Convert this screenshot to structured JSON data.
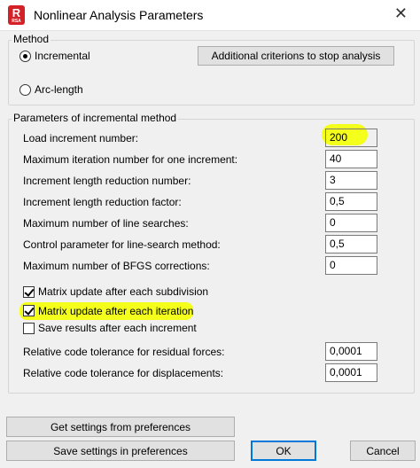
{
  "window": {
    "title": "Nonlinear Analysis Parameters",
    "app_icon_letter": "R",
    "app_icon_sub": "RSA",
    "close_glyph": "✕"
  },
  "method": {
    "group_label": "Method",
    "options": [
      {
        "label": "Incremental",
        "selected": true
      },
      {
        "label": "Arc-length",
        "selected": false
      }
    ],
    "additional_button": "Additional criterions to stop analysis"
  },
  "params": {
    "group_label": "Parameters of incremental method",
    "rows": [
      {
        "label": "Load increment number:",
        "value": "200"
      },
      {
        "label": "Maximum iteration number for one increment:",
        "value": "40"
      },
      {
        "label": "Increment length reduction number:",
        "value": "3"
      },
      {
        "label": "Increment length reduction factor:",
        "value": "0,5"
      },
      {
        "label": "Maximum number of line searches:",
        "value": "0"
      },
      {
        "label": "Control parameter for line-search method:",
        "value": "0,5"
      },
      {
        "label": "Maximum number of BFGS corrections:",
        "value": "0"
      }
    ],
    "checks": [
      {
        "label": "Matrix update after each subdivision",
        "checked": true
      },
      {
        "label": "Matrix update after each iteration",
        "checked": true
      },
      {
        "label": "Save results after each increment",
        "checked": false
      }
    ],
    "tolerances": [
      {
        "label": "Relative code tolerance for residual forces:",
        "value": "0,0001"
      },
      {
        "label": "Relative code tolerance for displacements:",
        "value": "0,0001"
      }
    ]
  },
  "buttons": {
    "get_settings": "Get settings from preferences",
    "save_settings": "Save settings in preferences",
    "ok": "OK",
    "cancel": "Cancel"
  },
  "colors": {
    "highlight": "#f4ff1c",
    "brand_red": "#d42027",
    "default_button_border": "#0078d7"
  }
}
